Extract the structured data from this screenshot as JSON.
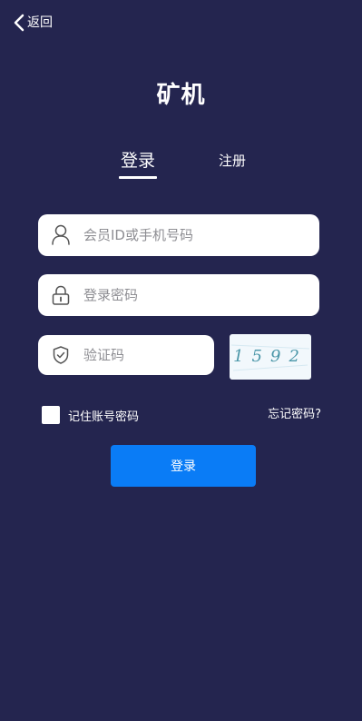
{
  "header": {
    "back_label": "返回",
    "back_icon": "chevron-left-icon"
  },
  "title": "矿机",
  "tabs": [
    {
      "label": "登录",
      "active": true
    },
    {
      "label": "注册",
      "active": false
    }
  ],
  "form": {
    "username": {
      "placeholder": "会员ID或手机号码",
      "value": "",
      "icon": "user-icon"
    },
    "password": {
      "placeholder": "登录密码",
      "value": "",
      "icon": "lock-icon"
    },
    "captcha": {
      "placeholder": "验证码",
      "value": "",
      "icon": "shield-icon",
      "image_text": "1592"
    },
    "remember": {
      "label": "记住账号密码",
      "checked": false
    },
    "forgot_label": "忘记密码?",
    "submit_label": "登录"
  },
  "colors": {
    "background": "#24254f",
    "accent": "#0a7cf6",
    "text": "#ffffff",
    "captcha_text": "#4a96a8"
  }
}
